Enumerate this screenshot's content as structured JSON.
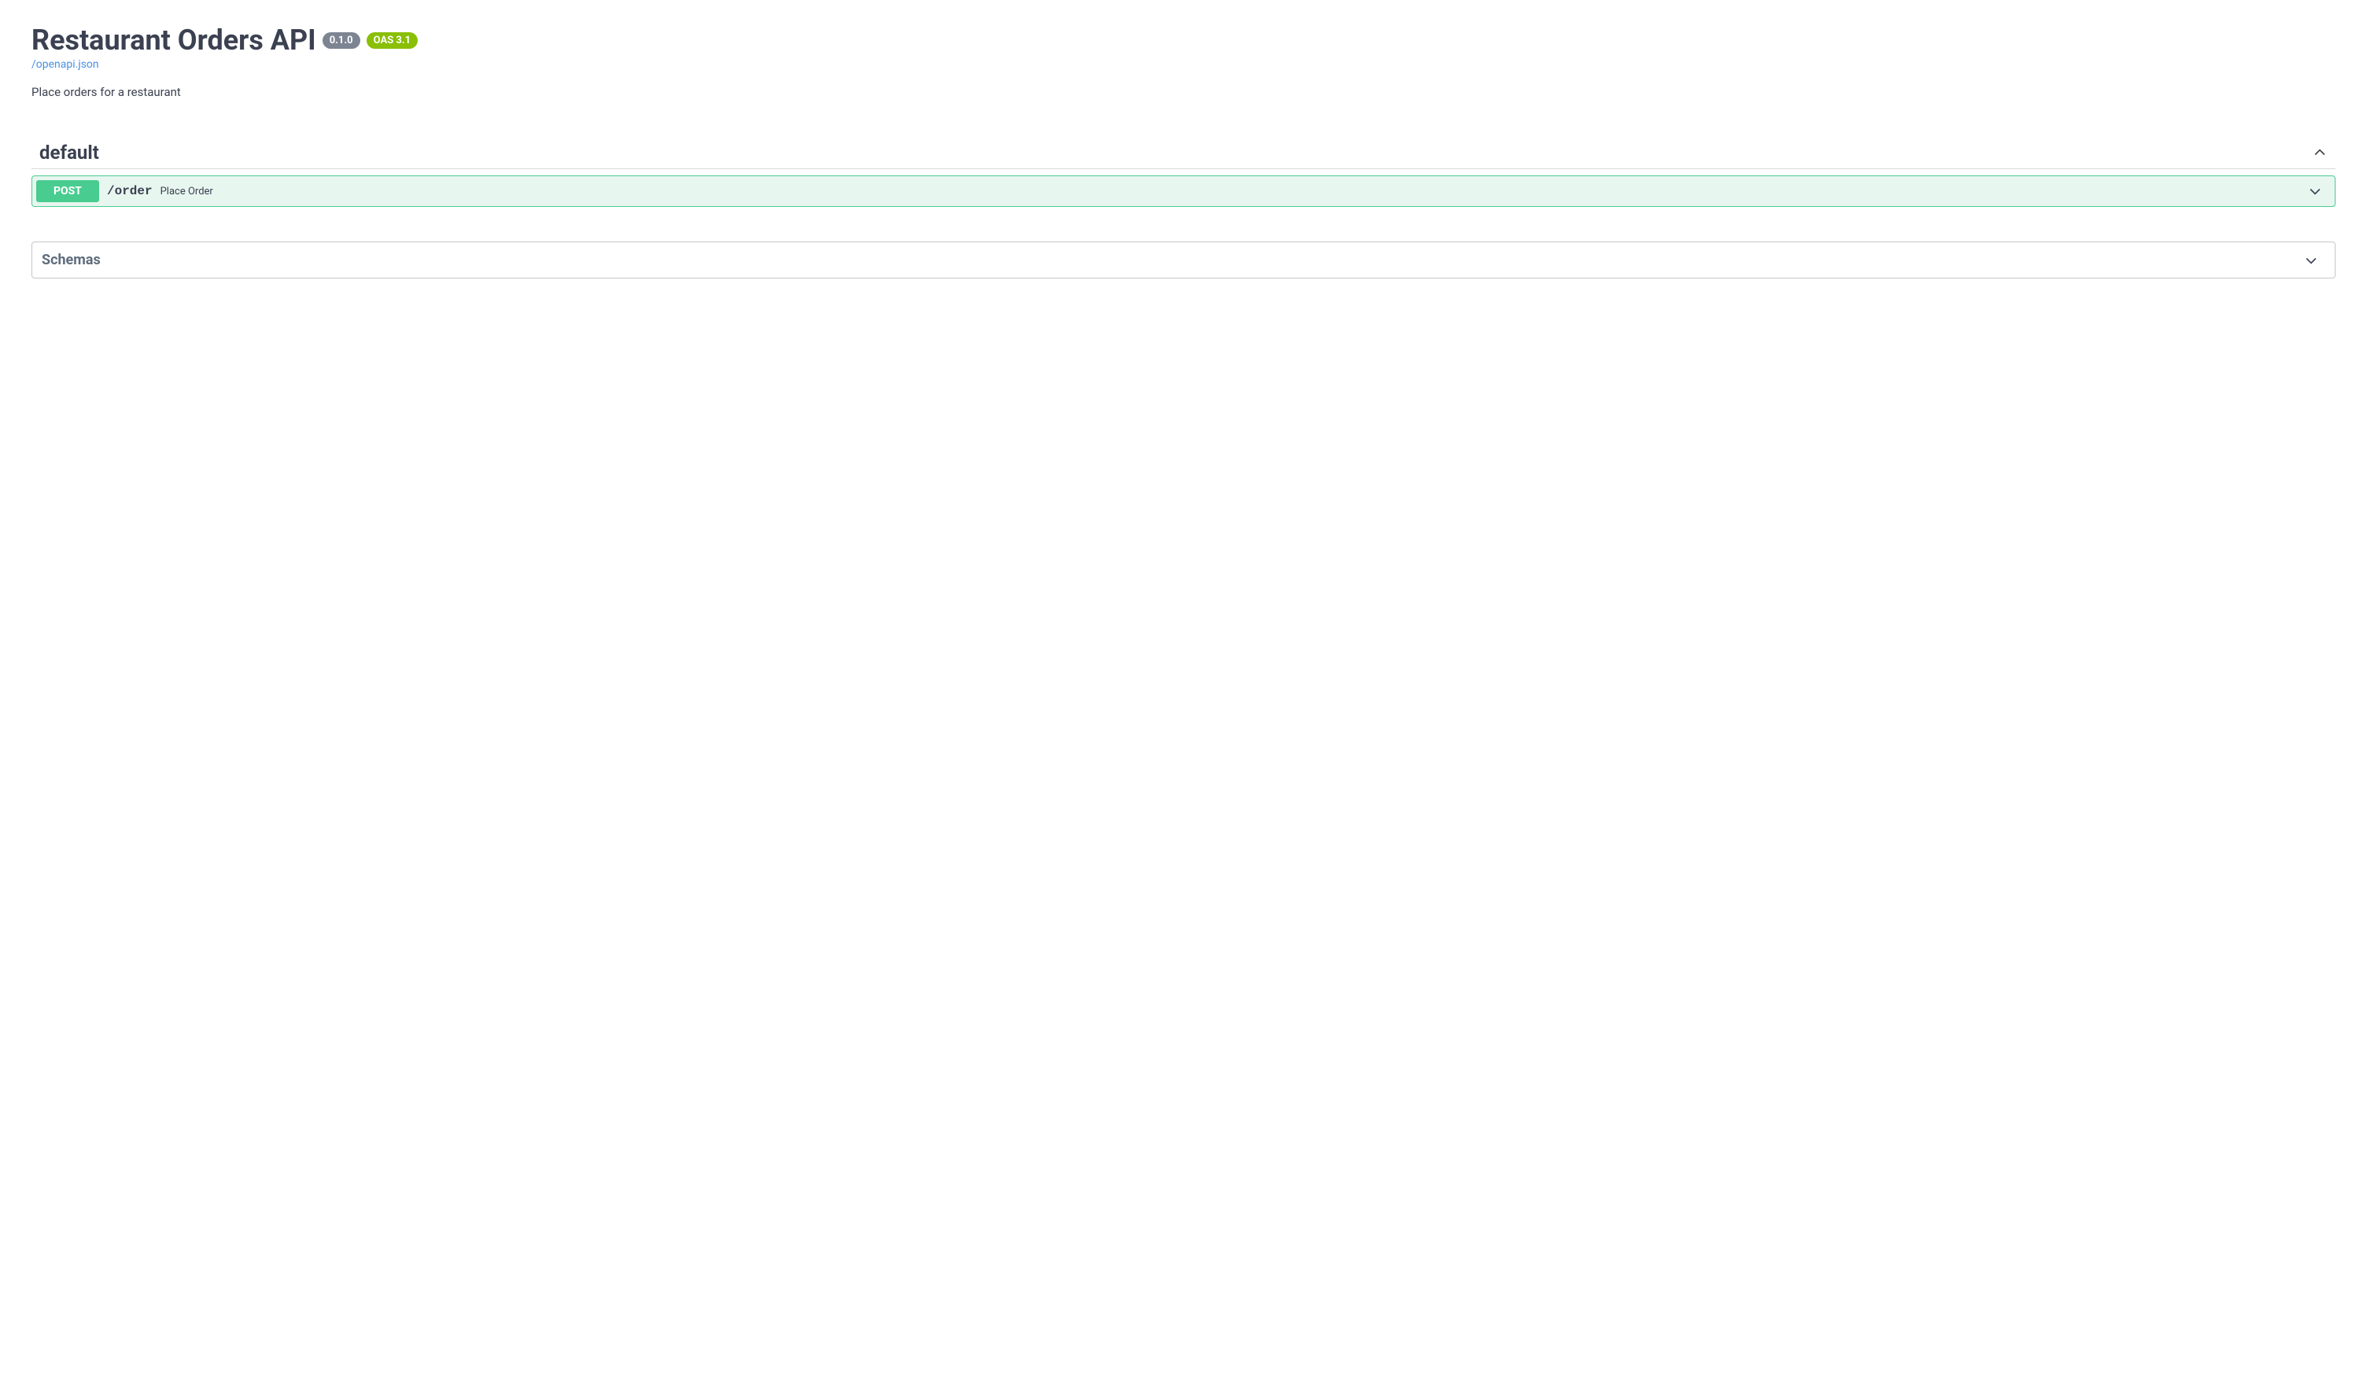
{
  "header": {
    "title": "Restaurant Orders API",
    "version": "0.1.0",
    "oas": "OAS 3.1",
    "spec_link": "/openapi.json",
    "description": "Place orders for a restaurant"
  },
  "tag": {
    "name": "default",
    "operations": [
      {
        "method": "POST",
        "path": "/order",
        "summary": "Place Order"
      }
    ]
  },
  "schemas": {
    "title": "Schemas"
  }
}
